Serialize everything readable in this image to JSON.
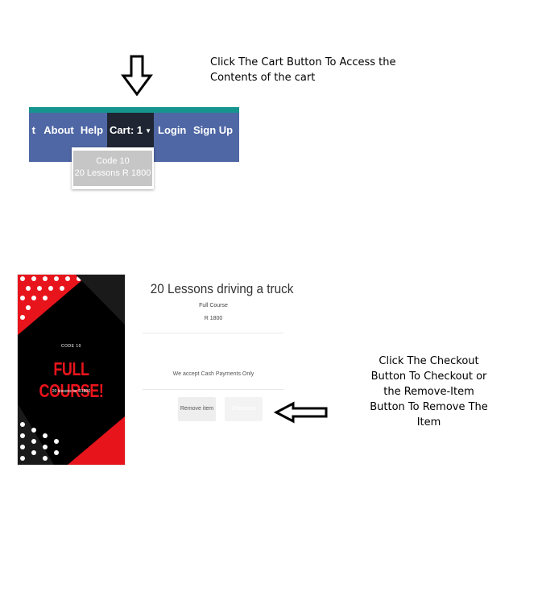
{
  "annotations": {
    "top": "Click The Cart Button To Access the Contents of the cart",
    "right": "Click The Checkout Button To Checkout or the Remove-Item Button To Remove The Item"
  },
  "navbar": {
    "partial_item": "t",
    "items": [
      "About",
      "Help",
      "Cart: 1",
      "Login",
      "Sign Up"
    ],
    "colors": {
      "bar": "#4f67a4",
      "top_strip": "#16948e",
      "active": "#1f2533"
    }
  },
  "cart_dropdown": {
    "line1": "Code 10",
    "line2": "20 Lessons R 1800"
  },
  "poster": {
    "code": "CODE 10",
    "title": "FULL COURSE!",
    "subtitle": "20 lessons for R1800",
    "colors": {
      "accent": "#e8141c",
      "background": "#000000"
    }
  },
  "product": {
    "title": "20 Lessons driving a truck",
    "type": "Full Course",
    "price": "R 1800",
    "payment_note": "We accept Cash Payments Only",
    "remove_label": "Remove item",
    "checkout_label": "Checkout"
  }
}
